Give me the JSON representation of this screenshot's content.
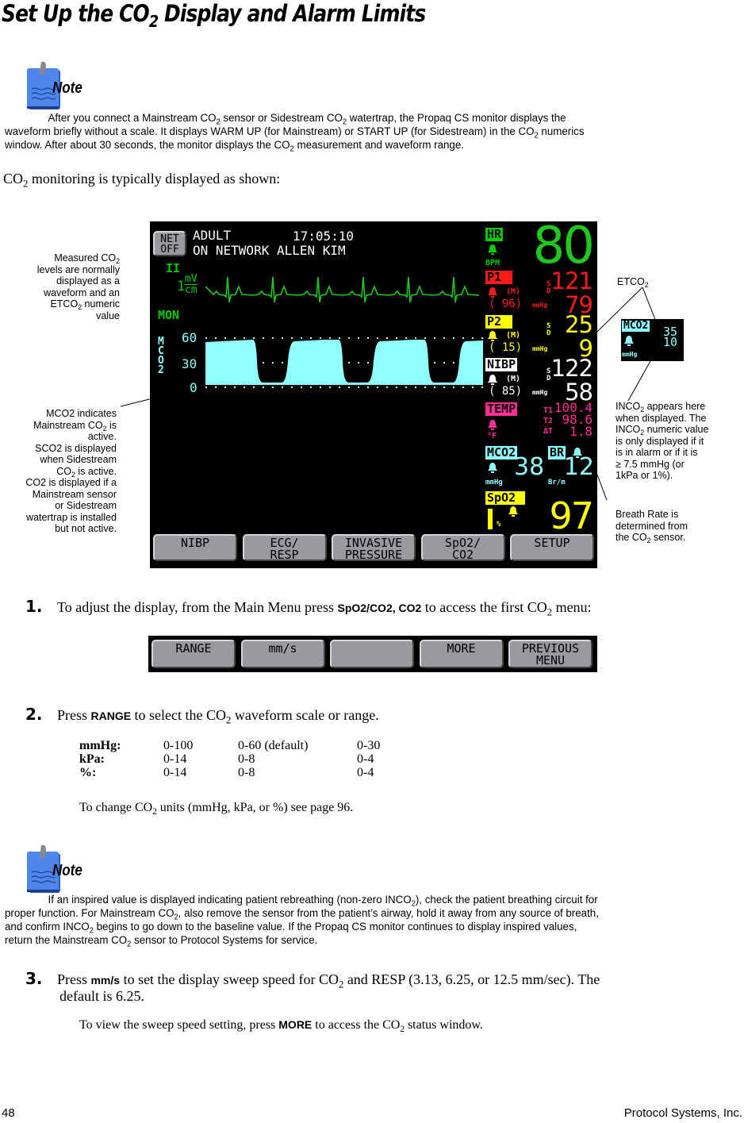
{
  "page": {
    "title_pre": "Set Up the CO",
    "title_sub": "2",
    "title_post": " Display and Alarm Limits",
    "footer_page": "48",
    "footer_company": "Protocol Systems, Inc."
  },
  "note1": {
    "label": "Note",
    "icon": "notepad-icon",
    "lines": [
      [
        "After you connect a Mainstream CO",
        "2",
        " sensor or Sidestream CO",
        "2",
        " watertrap, the Propaq CS monitor displays the"
      ],
      [
        "waveform briefly without a scale. It displays WARM UP (for Mainstream) or START UP (for Sidestream) in the CO",
        "2",
        " numerics"
      ],
      [
        "window. After about 30 seconds, the monitor displays the CO",
        "2",
        " measurement and waveform range."
      ]
    ]
  },
  "intro": {
    "pre": "CO",
    "sub": "2",
    "post": " monitoring is typically displayed as shown:"
  },
  "monitor": {
    "net_button": [
      "NET",
      "OFF"
    ],
    "patient_type": "ADULT",
    "time": "17:05:10",
    "network_status": "ON NETWORK ALLEN KIM",
    "ecg_lead": "II",
    "ecg_scale_num": "1",
    "ecg_scale_unit_top": "mV",
    "ecg_scale_unit_bottom": "cm",
    "ecg_mode": "MON",
    "co2_wave_label": [
      "M",
      "C",
      "O",
      "2"
    ],
    "co2_scale": [
      "60",
      "30",
      "0"
    ],
    "hr": {
      "label": "HR",
      "unit": "BPM",
      "value": "80"
    },
    "p1": {
      "label": "P1",
      "mean_label": "(M)",
      "mean": "( 96)",
      "unit": "mmHg",
      "s_label": "S",
      "d_label": "D",
      "systolic": "121",
      "diastolic": "79"
    },
    "p2": {
      "label": "P2",
      "mean_label": "(M)",
      "mean": "( 15)",
      "unit": "mmHg",
      "s_label": "S",
      "d_label": "D",
      "systolic": "25",
      "diastolic": "9"
    },
    "nibp": {
      "label": "NIBP",
      "mean_label": "(M)",
      "mean": "( 85)",
      "unit": "mmHg",
      "s_label": "S",
      "d_label": "D",
      "systolic": "122",
      "diastolic": "58"
    },
    "temp": {
      "label": "TEMP",
      "unit": "°F",
      "t1_label": "T1",
      "t2_label": "T2",
      "dt_label": "ΔT",
      "t1": "100.4",
      "t2": "98.6",
      "dt": "1.8"
    },
    "co2": {
      "label": "MCO2",
      "unit": "mmHg",
      "value": "38"
    },
    "br": {
      "label": "BR",
      "unit": "Br/m",
      "value": "12"
    },
    "spo2": {
      "label": "SpO2",
      "unit": "%",
      "value": "97"
    },
    "menu_buttons": [
      [
        "NIBP",
        ""
      ],
      [
        "ECG/",
        "RESP"
      ],
      [
        "INVASIVE",
        "PRESSURE"
      ],
      [
        "SpO2/",
        "CO2"
      ],
      [
        "SETUP",
        ""
      ]
    ],
    "colors": {
      "hr": "#00cc00",
      "p1": "#ff1a1a",
      "p2": "#ffff00",
      "nibp": "#ffffff",
      "temp": "#ff2d95",
      "co2": "#8fffff",
      "spo2": "#ffff00"
    }
  },
  "inset": {
    "label": "MCO2",
    "unit": "mmHg",
    "etco2": "35",
    "inco2": "10"
  },
  "callouts": {
    "measured": [
      "Measured CO|2",
      "levels are normally",
      "displayed as a",
      "waveform and an",
      "ETCO|2| numeric",
      "value"
    ],
    "mco2": [
      "MCO2 indicates",
      "Mainstream CO|2| is",
      "active.",
      "SCO2 is displayed",
      "when Sidestream",
      "CO|2| is active.",
      "CO2 is displayed if a",
      "Mainstream sensor",
      "or Sidestream",
      "watertrap is installed",
      "but not active."
    ],
    "etco2": [
      "ETCO|2"
    ],
    "inco2": [
      "INCO|2| appears here",
      "when displayed. The",
      "INCO|2| numeric value",
      "is only displayed if it",
      "is in alarm or if it is",
      "≥ 7.5 mmHg (or",
      "1kPa or 1%)."
    ],
    "br": [
      "Breath Rate is",
      "determined from",
      "the CO|2| sensor."
    ]
  },
  "step1": {
    "num": "1.",
    "pre": "To adjust the display, from the Main Menu press ",
    "key": "SpO2/CO2, CO2",
    "mid": " to access the first CO",
    "sub": "2",
    "post": " menu:",
    "menu_buttons": [
      [
        "RANGE",
        ""
      ],
      [
        "mm/s",
        ""
      ],
      [
        "",
        ""
      ],
      [
        "MORE",
        ""
      ],
      [
        "PREVIOUS",
        "MENU"
      ]
    ]
  },
  "step2": {
    "num": "2.",
    "pre": "Press ",
    "key": "RANGE",
    "mid": " to select the CO",
    "sub": "2",
    "post": " waveform scale or range.",
    "range_table": [
      [
        "mmHg:",
        "0-100",
        "0-60 (default)",
        "0-30"
      ],
      [
        "kPa:",
        "0-14",
        "0-8",
        "0-4"
      ],
      [
        "%:",
        "0-14",
        "0-8",
        "0-4"
      ]
    ],
    "units_note_pre": "To change CO",
    "units_note_sub": "2",
    "units_note_post": " units (mmHg, kPa, or %) see page 96."
  },
  "note2": {
    "label": "Note",
    "icon": "notepad-icon",
    "lines": [
      [
        "If an inspired value is displayed indicating patient rebreathing (non-zero INCO",
        "2",
        "), check the patient breathing circuit for"
      ],
      [
        "proper function. For Mainstream CO",
        "2",
        ", also remove the sensor from the patient’s airway, hold it away from any source of breath,"
      ],
      [
        "and confirm INCO",
        "2",
        " begins to go down to the baseline value. If the Propaq CS monitor continues to display inspired values,"
      ],
      [
        "return the Mainstream CO",
        "2",
        " sensor to Protocol Systems for service."
      ]
    ]
  },
  "step3": {
    "num": "3.",
    "pre": "Press ",
    "key": "mm/s",
    "mid": " to set the display sweep speed for CO",
    "sub": "2",
    "post": " and RESP (3.13, 6.25, or 12.5 mm/sec). The",
    "line2": "default is 6.25.",
    "sub_pre": "To view the sweep speed setting, press ",
    "sub_key": "MORE",
    "sub_mid": " to access the CO",
    "sub_sub": "2",
    "sub_post": " status window."
  }
}
